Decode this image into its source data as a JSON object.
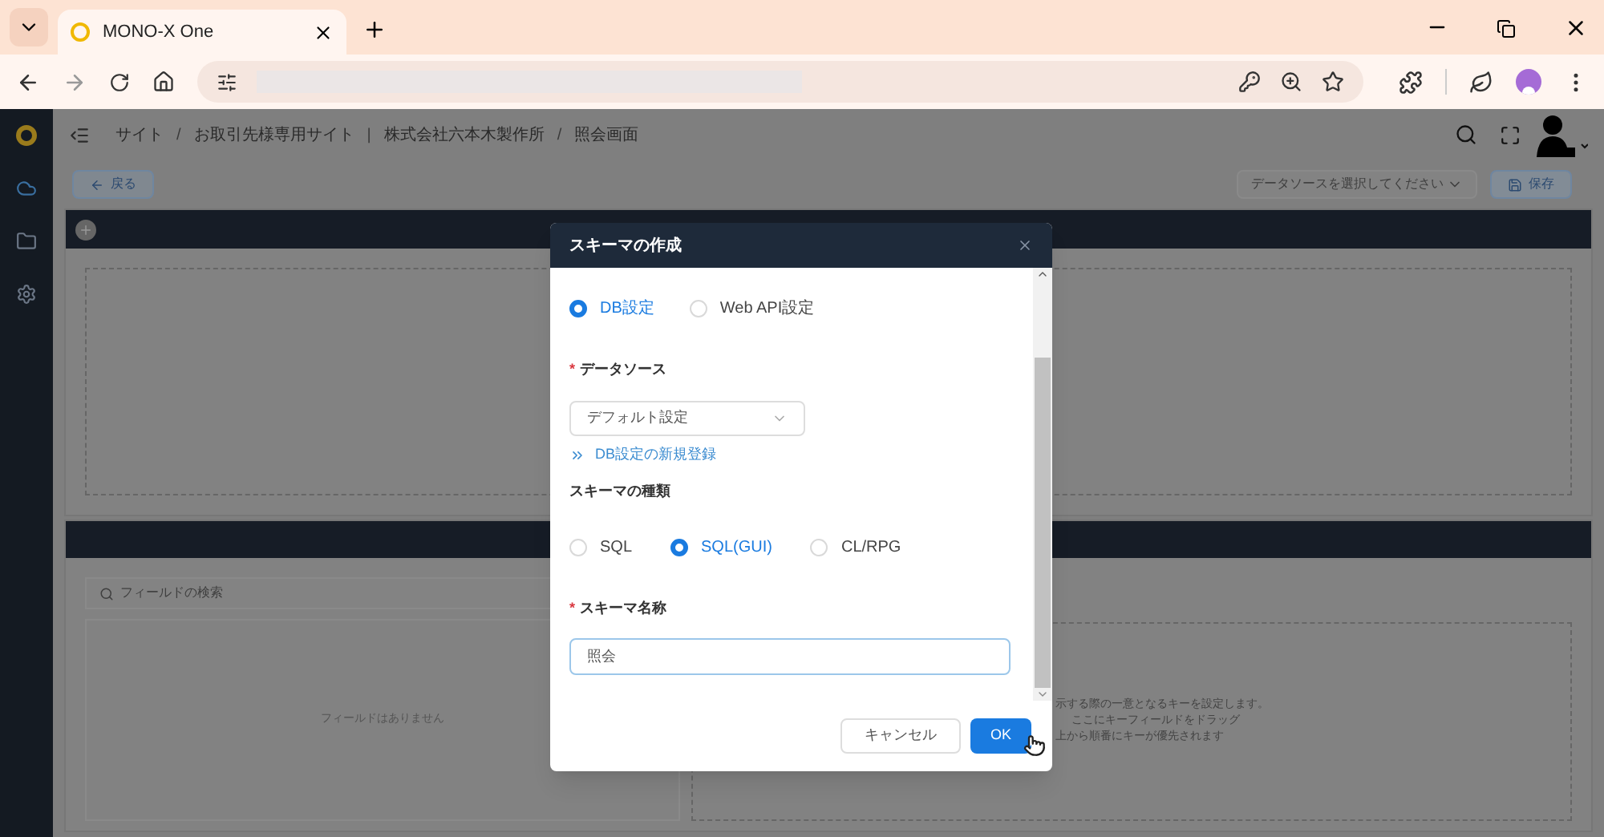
{
  "browser": {
    "tab_title": "MONO-X One"
  },
  "breadcrumb": [
    {
      "kind": "item",
      "text": "サイト"
    },
    {
      "kind": "separator",
      "text": "/"
    },
    {
      "kind": "item",
      "text": "お取引先様専用サイト"
    },
    {
      "kind": "separator",
      "text": "|"
    },
    {
      "kind": "item",
      "text": "株式会社六本木製作所"
    },
    {
      "kind": "separator",
      "text": "/"
    },
    {
      "kind": "item",
      "text": "照会画面"
    }
  ],
  "toolbar": {
    "back_button": "戻る",
    "datasource_select": {
      "placeholder": "データソースを選択してください"
    },
    "save_button": "保存"
  },
  "fields_panel": {
    "search": {
      "placeholder": "フィールドの検索"
    },
    "empty_text": "フィールドはありません",
    "key_hint": [
      "示する際の一意となるキーを設定します。",
      "ここにキーフィールドをドラッグ",
      "上から順番にキーが優先されます"
    ]
  },
  "dialog": {
    "title": "スキーマの作成",
    "source_options": [
      {
        "label": "DB設定",
        "selected": true
      },
      {
        "label": "Web API設定",
        "selected": false
      }
    ],
    "datasource": {
      "label": "データソース",
      "required_mark": "*",
      "value": "デフォルト設定"
    },
    "new_db_link": "DB設定の新規登録",
    "schema_type": {
      "label": "スキーマの種類",
      "options": [
        {
          "label": "SQL",
          "selected": false
        },
        {
          "label": "SQL(GUI)",
          "selected": true
        },
        {
          "label": "CL/RPG",
          "selected": false
        }
      ]
    },
    "schema_name": {
      "label": "スキーマ名称",
      "required_mark": "*",
      "value": "照会"
    },
    "buttons": {
      "cancel": "キャンセル",
      "ok": "OK"
    }
  }
}
